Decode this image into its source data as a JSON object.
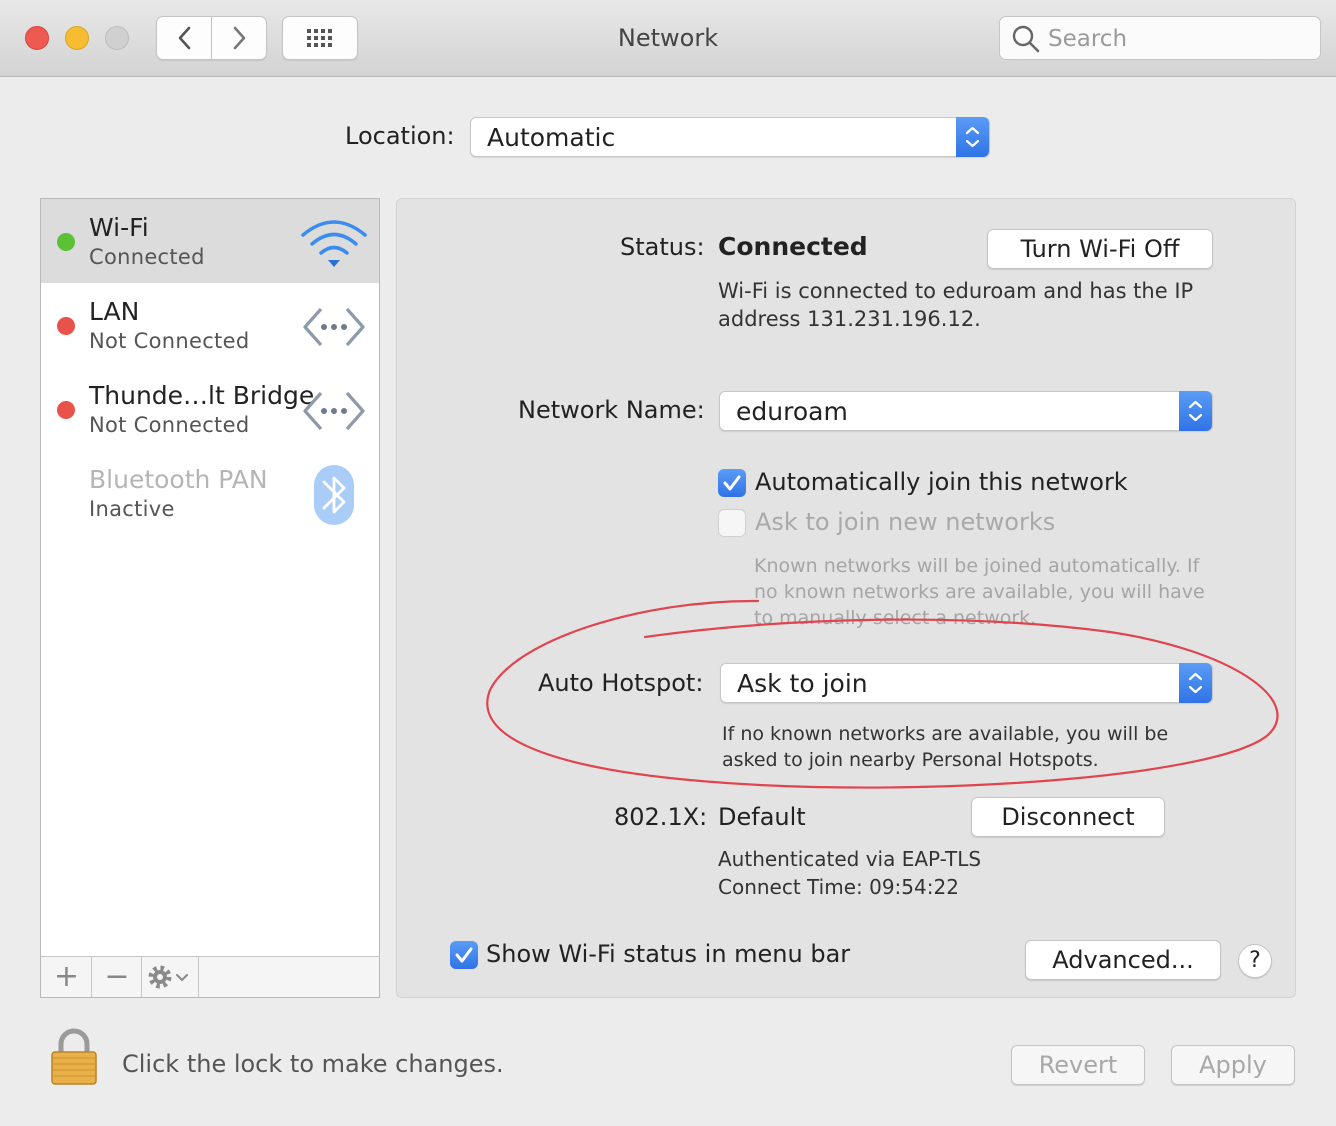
{
  "window": {
    "title": "Network",
    "search_placeholder": "Search"
  },
  "location": {
    "label": "Location:",
    "value": "Automatic"
  },
  "services": [
    {
      "name": "Wi-Fi",
      "status": "Connected",
      "status_color": "#5bc236",
      "icon": "wifi-icon",
      "selected": true
    },
    {
      "name": "LAN",
      "status": "Not Connected",
      "status_color": "#e9524a",
      "icon": "ethernet-icon"
    },
    {
      "name": "Thunde…lt Bridge",
      "status": "Not Connected",
      "status_color": "#e9524a",
      "icon": "ethernet-icon"
    },
    {
      "name": "Bluetooth PAN",
      "status": "Inactive",
      "status_color": null,
      "icon": "bluetooth-icon"
    }
  ],
  "sidebar_toolbar": {
    "add": "+",
    "remove": "−"
  },
  "status": {
    "label": "Status:",
    "value": "Connected",
    "turn_off_button": "Turn Wi-Fi Off",
    "description_line1": "Wi-Fi is connected to eduroam and has the IP",
    "description_line2": "address 131.231.196.12."
  },
  "network_name": {
    "label": "Network Name:",
    "value": "eduroam"
  },
  "options": {
    "auto_join": {
      "label": "Automatically join this network",
      "checked": true
    },
    "ask_join": {
      "label": "Ask to join new networks",
      "checked": false,
      "enabled": false
    },
    "help_line1": "Known networks will be joined automatically. If",
    "help_line2": "no known networks are available, you will have",
    "help_line3": "to manually select a network."
  },
  "auto_hotspot": {
    "label": "Auto Hotspot:",
    "value": "Ask to join",
    "help_line1": "If no known networks are available, you will be",
    "help_line2": "asked to join nearby Personal Hotspots."
  },
  "dot1x": {
    "label": "802.1X:",
    "value": "Default",
    "disconnect_button": "Disconnect",
    "auth_line": "Authenticated via EAP-TLS",
    "connect_time": "Connect Time: 09:54:22"
  },
  "show_menu_bar": {
    "label": "Show Wi-Fi status in menu bar",
    "checked": true
  },
  "advanced_button": "Advanced...",
  "help_button": "?",
  "lock_text": "Click the lock to make changes.",
  "revert_button": "Revert",
  "apply_button": "Apply",
  "colors": {
    "accent": "#2f73e6",
    "annotation": "#e0454f"
  }
}
